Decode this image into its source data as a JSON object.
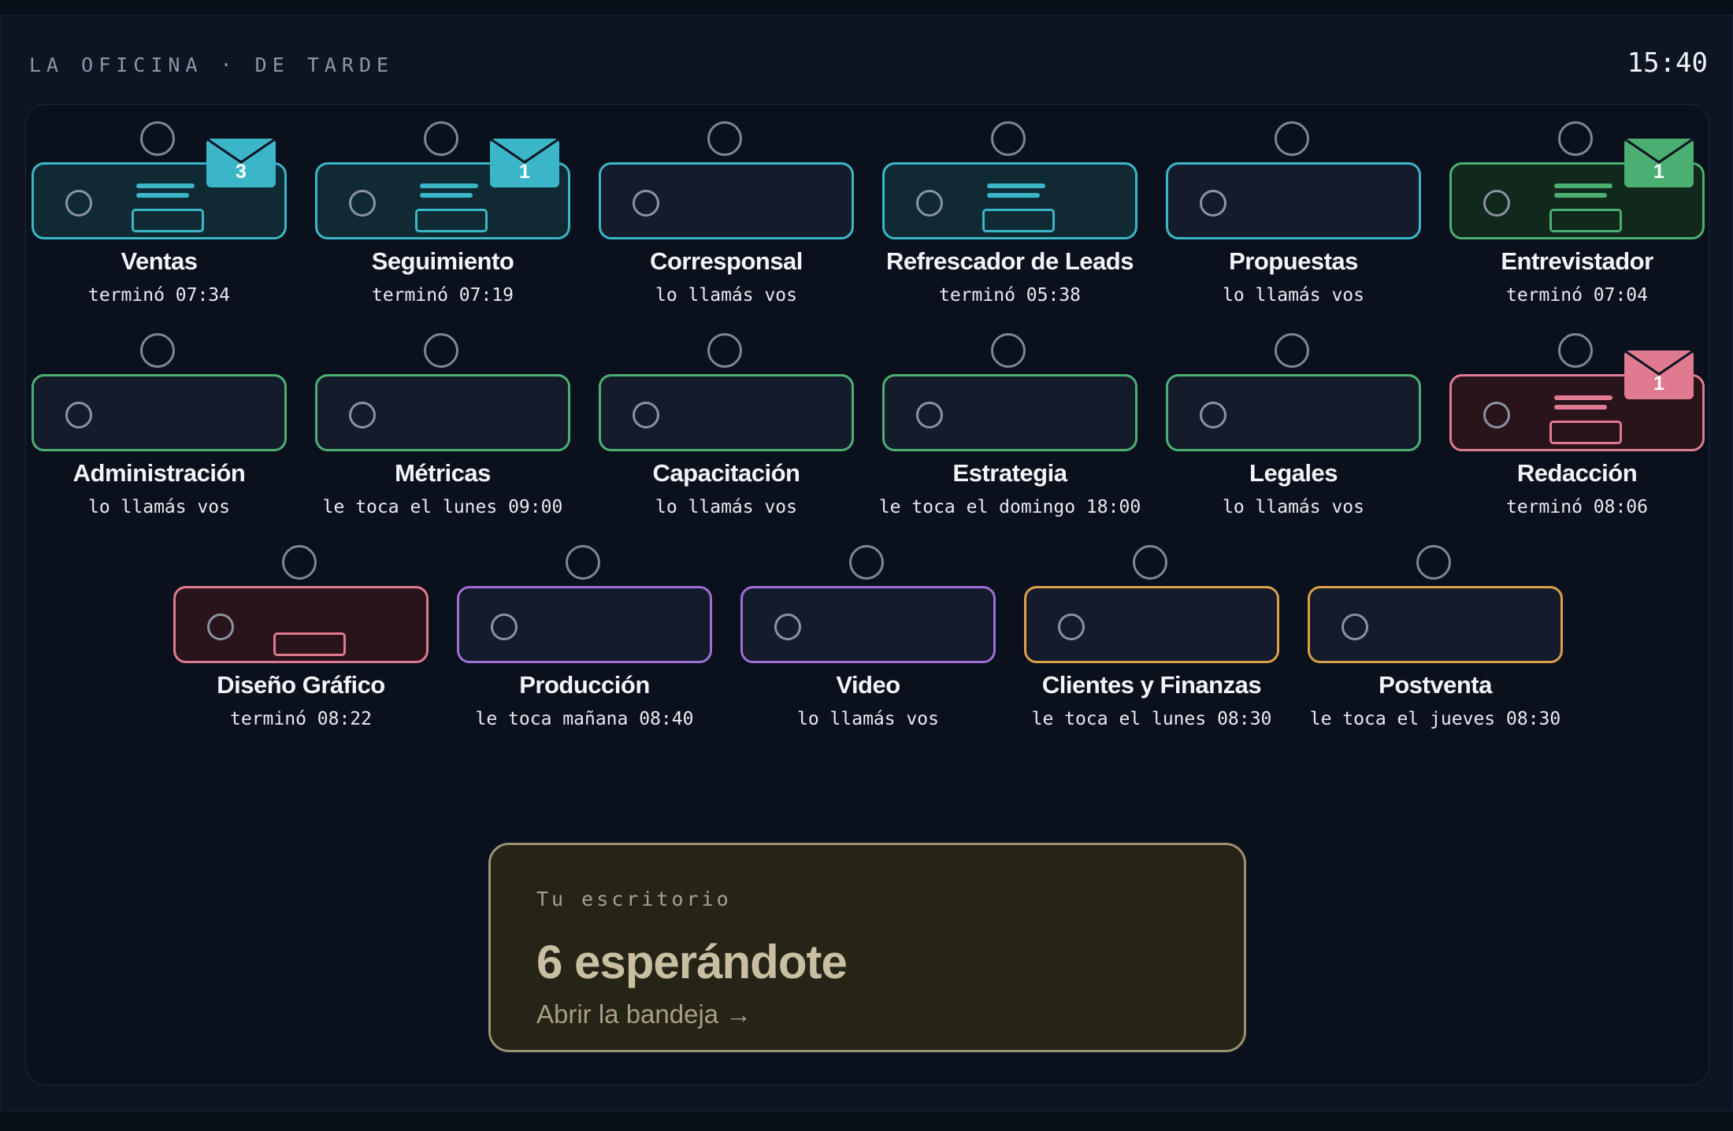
{
  "header": {
    "title": "LA OFICINA · DE TARDE",
    "clock": "15:40"
  },
  "colors": {
    "cyan": "#3bb6c8",
    "green": "#4caf72",
    "red": "#e07a90",
    "purple": "#a06fd6",
    "amber": "#dba04a"
  },
  "desks": [
    {
      "name": "Ventas",
      "status": "terminó 07:34",
      "color": "cyan",
      "papers": true,
      "mail": "3"
    },
    {
      "name": "Seguimiento",
      "status": "terminó 07:19",
      "color": "cyan",
      "papers": true,
      "mail": "1"
    },
    {
      "name": "Corresponsal",
      "status": "lo llamás vos",
      "color": "cyan",
      "papers": false,
      "mail": null
    },
    {
      "name": "Refrescador de Leads",
      "status": "terminó 05:38",
      "color": "cyan",
      "papers": true,
      "mail": null
    },
    {
      "name": "Propuestas",
      "status": "lo llamás vos",
      "color": "cyan",
      "papers": false,
      "mail": null
    },
    {
      "name": "Entrevistador",
      "status": "terminó 07:04",
      "color": "green",
      "papers": true,
      "mail": "1"
    },
    {
      "name": "Administración",
      "status": "lo llamás vos",
      "color": "green",
      "papers": false,
      "mail": null
    },
    {
      "name": "Métricas",
      "status": "le toca el lunes 09:00",
      "color": "green",
      "papers": false,
      "mail": null
    },
    {
      "name": "Capacitación",
      "status": "lo llamás vos",
      "color": "green",
      "papers": false,
      "mail": null
    },
    {
      "name": "Estrategia",
      "status": "le toca el domingo 18:00",
      "color": "green",
      "papers": false,
      "mail": null
    },
    {
      "name": "Legales",
      "status": "lo llamás vos",
      "color": "green",
      "papers": false,
      "mail": null
    },
    {
      "name": "Redacción",
      "status": "terminó 08:06",
      "color": "red",
      "papers": true,
      "mail": "1"
    },
    {
      "name": "Diseño Gráfico",
      "status": "terminó 08:22",
      "color": "red",
      "papers": "tray",
      "mail": null
    },
    {
      "name": "Producción",
      "status": "le toca mañana 08:40",
      "color": "purple",
      "papers": false,
      "mail": null
    },
    {
      "name": "Video",
      "status": "lo llamás vos",
      "color": "purple",
      "papers": false,
      "mail": null
    },
    {
      "name": "Clientes y Finanzas",
      "status": "le toca el lunes 08:30",
      "color": "amber",
      "papers": false,
      "mail": null
    },
    {
      "name": "Postventa",
      "status": "le toca el jueves 08:30",
      "color": "amber",
      "papers": false,
      "mail": null
    }
  ],
  "inbox": {
    "label": "Tu escritorio",
    "count": "6 esperándote",
    "link": "Abrir la bandeja →"
  }
}
